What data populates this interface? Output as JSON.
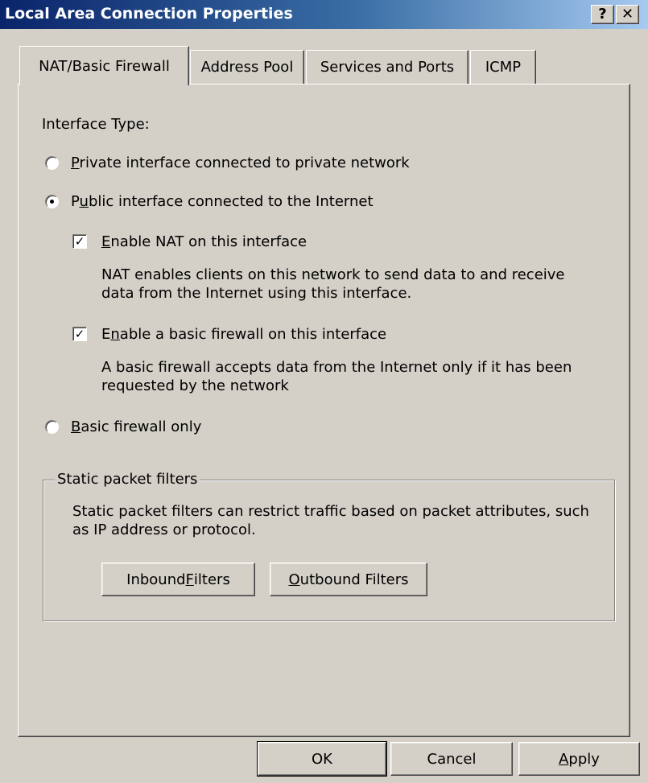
{
  "window": {
    "title": "Local Area Connection Properties",
    "help_label": "?",
    "close_label": "✕"
  },
  "tabs": [
    {
      "label": "NAT/Basic Firewall",
      "active": true
    },
    {
      "label": "Address Pool",
      "active": false
    },
    {
      "label": "Services and Ports",
      "active": false
    },
    {
      "label": "ICMP",
      "active": false
    }
  ],
  "main": {
    "interface_type_label": "Interface Type:",
    "radio_private": {
      "mnemonic": "P",
      "rest": "rivate interface connected to private network",
      "checked": false
    },
    "radio_public": {
      "before": "P",
      "mnemonic": "u",
      "rest": "blic interface connected to the Internet",
      "checked": true
    },
    "check_nat": {
      "mnemonic": "E",
      "rest": "nable NAT on this interface",
      "checked": true
    },
    "nat_description_line1": "NAT enables clients on this network to send data to and receive",
    "nat_description_line2": "data from the Internet using this interface.",
    "check_firewall": {
      "before": "E",
      "mnemonic": "n",
      "rest": "able a basic firewall on this interface",
      "checked": true
    },
    "firewall_description_line1": "A basic firewall accepts data from the Internet only if it has been",
    "firewall_description_line2": "requested by the network",
    "radio_basic": {
      "mnemonic": "B",
      "rest": "asic firewall only",
      "checked": false
    }
  },
  "static_filters": {
    "legend": "Static packet filters",
    "description_line1": "Static packet filters can restrict traffic based on packet attributes, such",
    "description_line2": "as IP address or protocol.",
    "inbound": {
      "before": "Inbound ",
      "mnemonic": "F",
      "rest": "ilters"
    },
    "outbound": {
      "mnemonic": "O",
      "rest": "utbound Filters"
    }
  },
  "footer": {
    "ok_label": "OK",
    "cancel_label": "Cancel",
    "apply": {
      "mnemonic": "A",
      "rest": "pply"
    }
  }
}
